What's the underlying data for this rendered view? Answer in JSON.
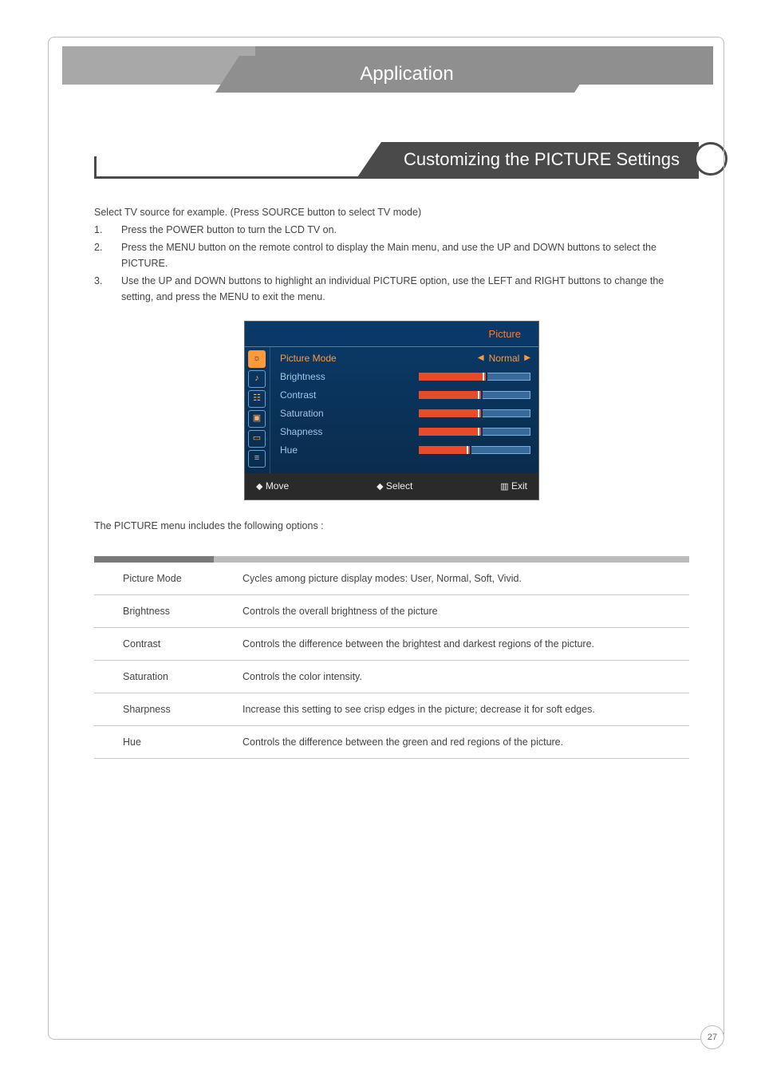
{
  "header": {
    "title": "Application"
  },
  "section": {
    "heading": "Customizing the PICTURE Settings"
  },
  "intro": "Select TV source for example. (Press SOURCE button to select TV mode)",
  "steps": [
    "Press the POWER button to turn the LCD TV on.",
    "Press the MENU button on the remote control to display the Main menu, and use the UP and DOWN buttons to select the PICTURE.",
    "Use the UP and DOWN buttons to highlight an individual PICTURE option, use the LEFT and RIGHT buttons to change the setting, and press the MENU to exit the menu."
  ],
  "osd": {
    "title": "Picture",
    "items": [
      {
        "label": "Picture Mode",
        "value": "Normal",
        "type": "enum",
        "selected": true
      },
      {
        "label": "Brightness",
        "type": "slider",
        "fill": 60
      },
      {
        "label": "Contrast",
        "type": "slider",
        "fill": 55
      },
      {
        "label": "Saturation",
        "type": "slider",
        "fill": 55
      },
      {
        "label": "Shapness",
        "type": "slider",
        "fill": 55
      },
      {
        "label": "Hue",
        "type": "slider",
        "fill": 45
      }
    ],
    "footer": {
      "move": "Move",
      "select": "Select",
      "exit": "Exit"
    }
  },
  "menu_note": "The PICTURE menu includes the following options :",
  "options": [
    {
      "name": "Picture Mode",
      "desc": "Cycles among picture display modes: User, Normal, Soft, Vivid."
    },
    {
      "name": "Brightness",
      "desc": "Controls the overall brightness of the picture"
    },
    {
      "name": "Contrast",
      "desc": "Controls the difference between the brightest and darkest regions of the picture."
    },
    {
      "name": "Saturation",
      "desc": "Controls the color intensity."
    },
    {
      "name": "Sharpness",
      "desc": "Increase this setting to see crisp edges in the picture; decrease it for soft edges."
    },
    {
      "name": "Hue",
      "desc": "Controls the difference between the green and red regions of the picture."
    }
  ],
  "page": "27"
}
